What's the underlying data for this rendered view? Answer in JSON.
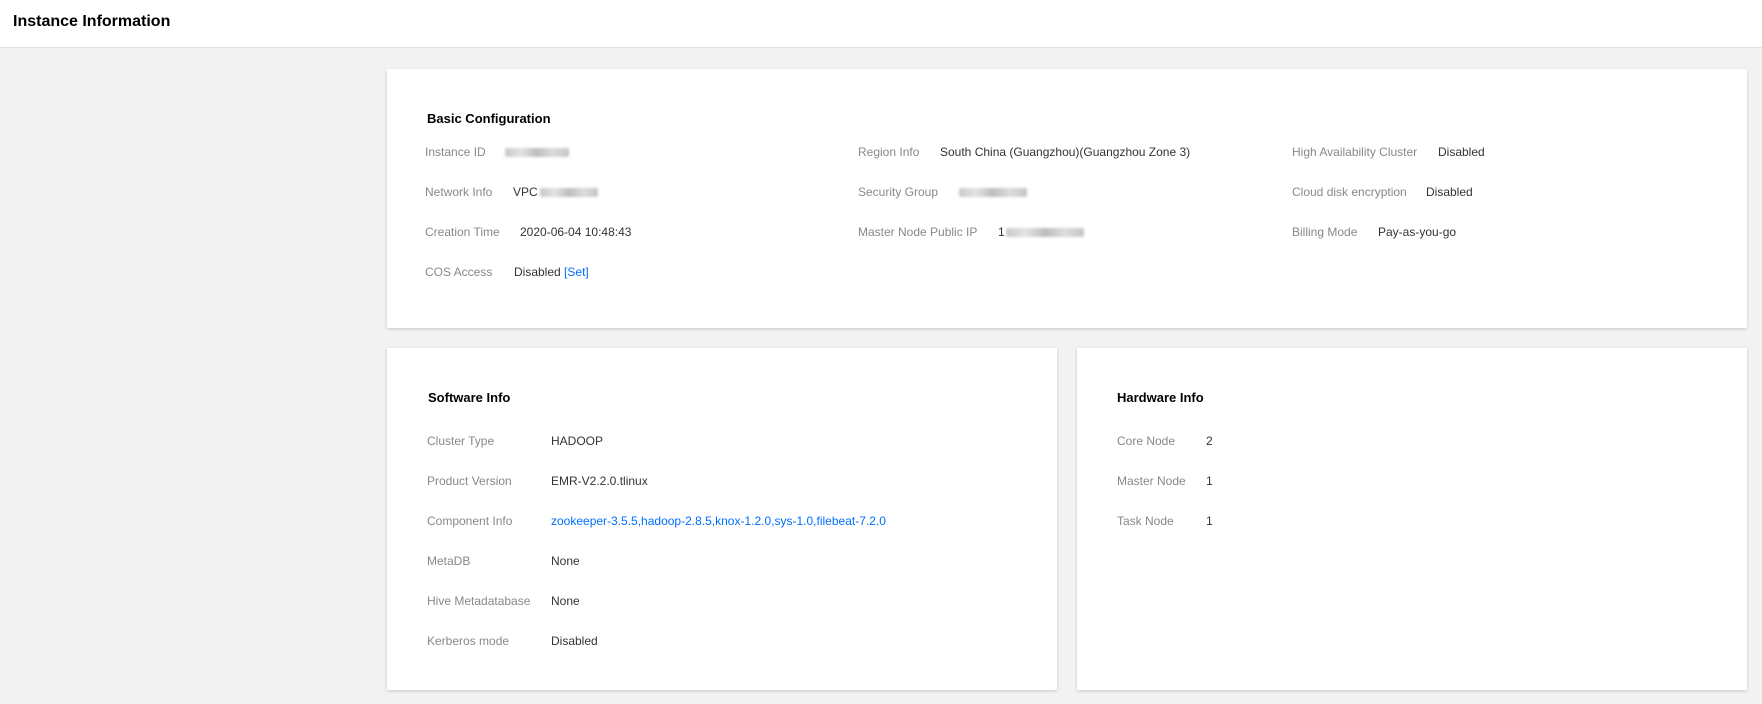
{
  "page": {
    "title": "Instance Information"
  },
  "basic": {
    "title": "Basic Configuration",
    "instance_id": {
      "label": "Instance ID"
    },
    "network_info": {
      "label": "Network Info",
      "value_prefix": "VPC"
    },
    "creation_time": {
      "label": "Creation Time",
      "value": "2020-06-04 10:48:43"
    },
    "cos_access": {
      "label": "COS Access",
      "value": "Disabled",
      "bracket_open": "[",
      "link": "Set",
      "bracket_close": "]"
    },
    "region_info": {
      "label": "Region Info",
      "value": "South China (Guangzhou)(Guangzhou Zone 3)"
    },
    "security_group": {
      "label": "Security Group"
    },
    "master_public_ip": {
      "label": "Master Node Public IP",
      "value_prefix": "1"
    },
    "ha_cluster": {
      "label": "High Availability Cluster",
      "value": "Disabled"
    },
    "disk_encryption": {
      "label": "Cloud disk encryption",
      "value": "Disabled"
    },
    "billing_mode": {
      "label": "Billing Mode",
      "value": "Pay-as-you-go"
    }
  },
  "software": {
    "title": "Software Info",
    "cluster_type": {
      "label": "Cluster Type",
      "value": "HADOOP"
    },
    "product_version": {
      "label": "Product Version",
      "value": "EMR-V2.2.0.tlinux"
    },
    "component_info": {
      "label": "Component Info",
      "value": "zookeeper-3.5.5,hadoop-2.8.5,knox-1.2.0,sys-1.0,filebeat-7.2.0"
    },
    "metadb": {
      "label": "MetaDB",
      "value": "None"
    },
    "hive_metadatabase": {
      "label": "Hive Metadatabase",
      "value": "None"
    },
    "kerberos_mode": {
      "label": "Kerberos mode",
      "value": "Disabled"
    }
  },
  "hardware": {
    "title": "Hardware Info",
    "core_node": {
      "label": "Core Node",
      "value": "2"
    },
    "master_node": {
      "label": "Master Node",
      "value": "1"
    },
    "task_node": {
      "label": "Task Node",
      "value": "1"
    }
  },
  "colors": {
    "link": "#006eff",
    "label": "#888888",
    "background": "#f2f2f2"
  }
}
